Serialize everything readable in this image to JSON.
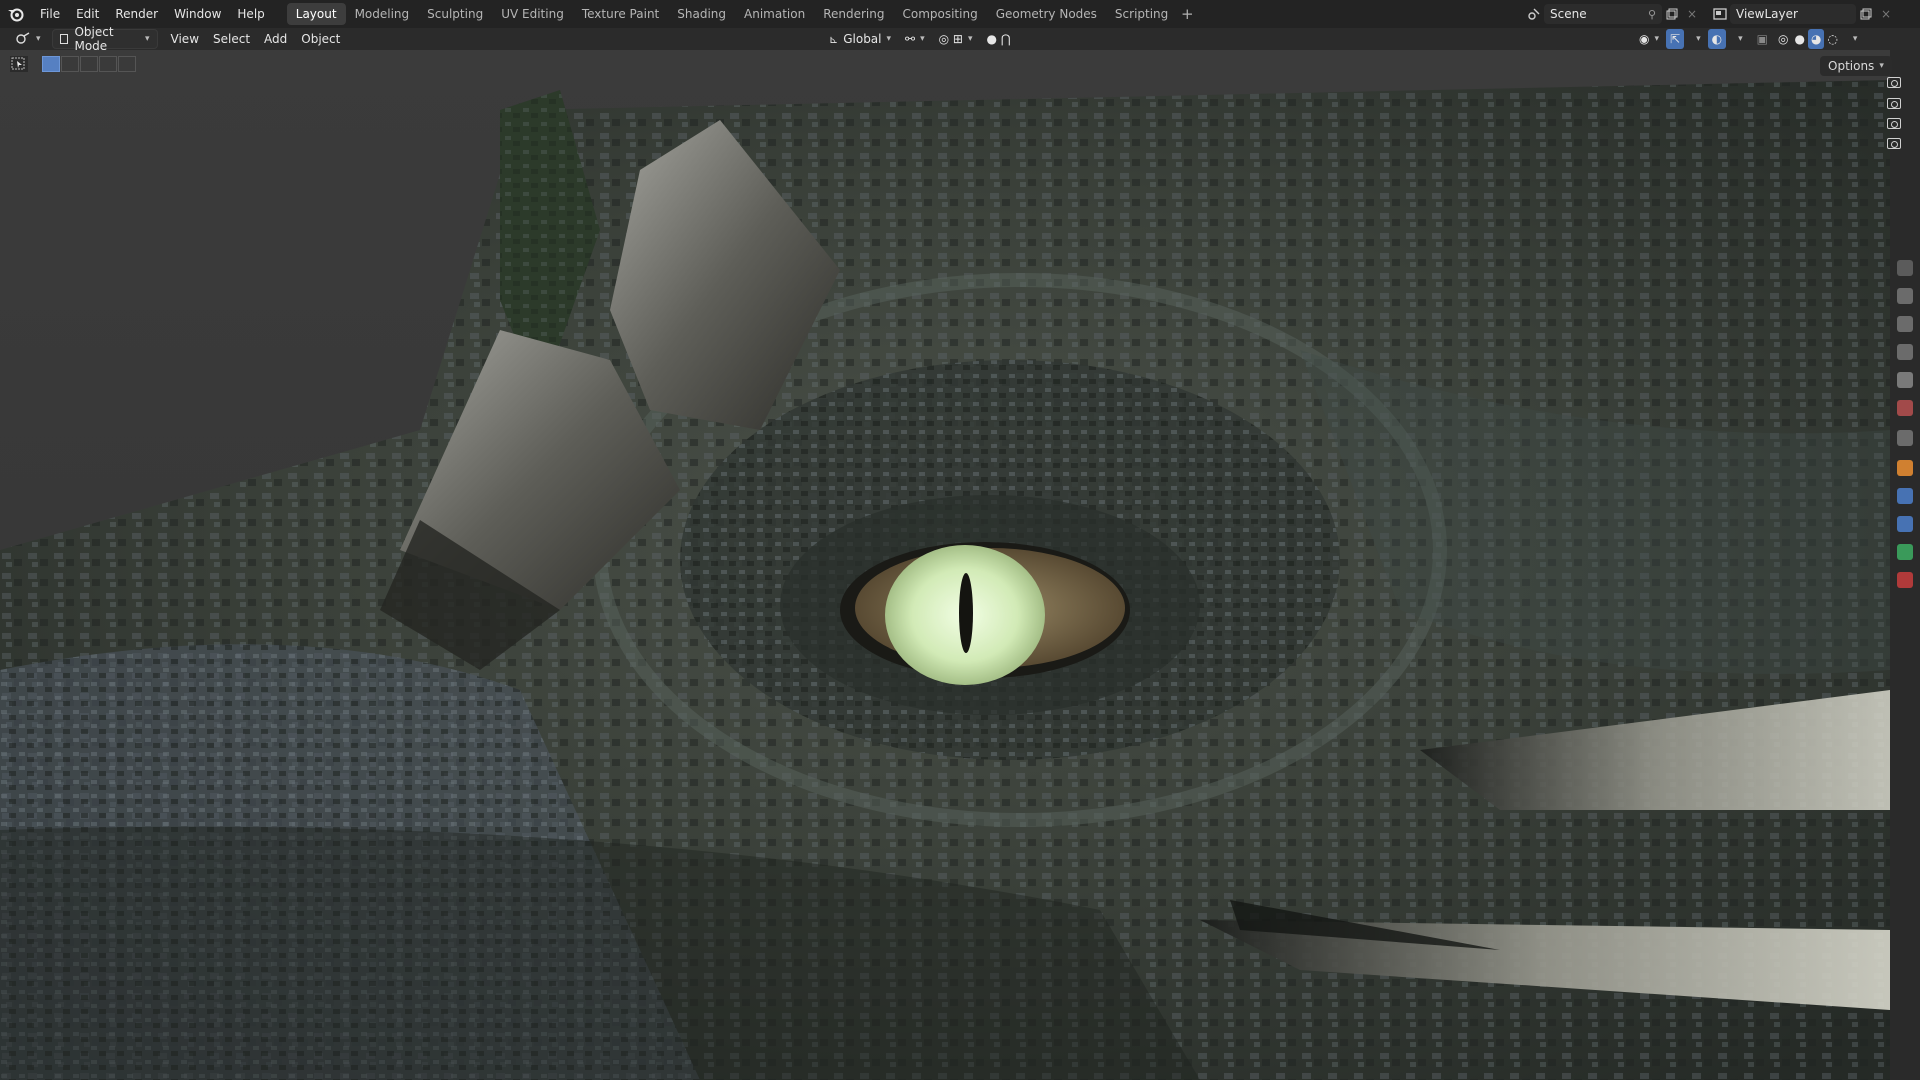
{
  "app": {
    "name": "Blender"
  },
  "menu": [
    "File",
    "Edit",
    "Render",
    "Window",
    "Help"
  ],
  "workspaces": [
    {
      "label": "Layout",
      "active": true
    },
    {
      "label": "Modeling"
    },
    {
      "label": "Sculpting"
    },
    {
      "label": "UV Editing"
    },
    {
      "label": "Texture Paint"
    },
    {
      "label": "Shading"
    },
    {
      "label": "Animation"
    },
    {
      "label": "Rendering"
    },
    {
      "label": "Compositing"
    },
    {
      "label": "Geometry Nodes"
    },
    {
      "label": "Scripting"
    }
  ],
  "scene": {
    "name": "Scene",
    "view_layer": "ViewLayer"
  },
  "header": {
    "mode": "Object Mode",
    "menus": [
      "View",
      "Select",
      "Add",
      "Object"
    ],
    "transform_orientation": "Global"
  },
  "viewport": {
    "options_label": "Options"
  },
  "colors": {
    "accent": "#4772b3",
    "topbar": "#232323",
    "header": "#2b2b2b",
    "viewport_bg": "#393939",
    "eye_glow": "#cfe8b2"
  },
  "icons": [
    "blender-logo-icon",
    "scene-icon",
    "view-layer-icon",
    "pin-icon",
    "close-icon",
    "editor-type-icon",
    "object-mode-icon",
    "orientation-icon",
    "pivot-icon",
    "snap-icon",
    "proportional-icon",
    "visibility-icon",
    "gizmo-icon",
    "overlay-icon",
    "xray-icon",
    "shading-solid-icon",
    "shading-material-icon",
    "shading-rendered-icon",
    "camera-icon"
  ]
}
